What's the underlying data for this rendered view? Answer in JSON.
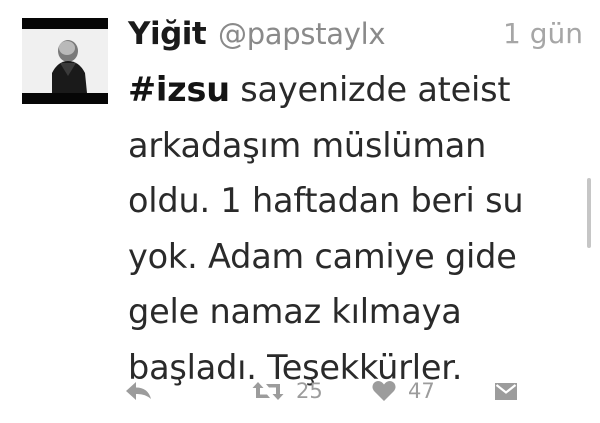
{
  "tweet": {
    "author_name": "Yiğit",
    "author_handle": "@papstaylx",
    "time": "1 gün",
    "hashtag": "#izsu",
    "text_lines": [
      " sayenizde ateist",
      "arkadaşım müslüman",
      "oldu. 1 haftadan beri su",
      "yok. Adam camiye gide",
      "gele namaz kılmaya",
      "başladı. Teşekkürler."
    ]
  },
  "actions": {
    "reply_icon": "reply-icon",
    "retweet_icon": "retweet-icon",
    "retweet_count": "25",
    "like_icon": "heart-icon",
    "like_count": "47",
    "message_icon": "envelope-icon"
  },
  "colors": {
    "background": "#ffffff",
    "name": "#1a1a1a",
    "muted": "#8a8a8a",
    "icon": "#9c9c9c"
  }
}
